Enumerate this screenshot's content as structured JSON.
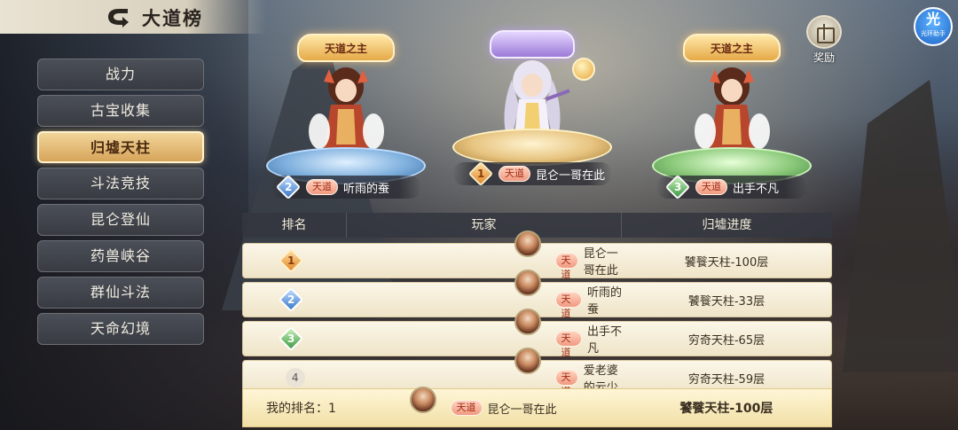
{
  "header": {
    "title": "大道榜"
  },
  "sidebar": {
    "items": [
      {
        "label": "战力",
        "active": false
      },
      {
        "label": "古宝收集",
        "active": false
      },
      {
        "label": "归墟天柱",
        "active": true
      },
      {
        "label": "斗法竞技",
        "active": false
      },
      {
        "label": "昆仑登仙",
        "active": false
      },
      {
        "label": "药兽峡谷",
        "active": false
      },
      {
        "label": "群仙斗法",
        "active": false
      },
      {
        "label": "天命幻境",
        "active": false
      }
    ]
  },
  "podiums": {
    "first": {
      "rank": "1",
      "crest": "",
      "tag": "天道",
      "name": "昆仑一哥在此"
    },
    "second": {
      "rank": "2",
      "crest": "天道之主",
      "tag": "天道",
      "name": "听雨的蚕"
    },
    "third": {
      "rank": "3",
      "crest": "天道之主",
      "tag": "天道",
      "name": "出手不凡"
    }
  },
  "reward": {
    "label": "奖励",
    "icon": "gift-icon"
  },
  "assist": {
    "big": "光",
    "small": "光环助手"
  },
  "table": {
    "headers": {
      "rank": "排名",
      "player": "玩家",
      "progress": "归墟进度"
    },
    "rows": [
      {
        "rank": "1",
        "tag": "天道",
        "name": "昆仑一哥在此",
        "progress": "饕餮天柱-100层"
      },
      {
        "rank": "2",
        "tag": "天道",
        "name": "听雨的蚕",
        "progress": "饕餮天柱-33层"
      },
      {
        "rank": "3",
        "tag": "天道",
        "name": "出手不凡",
        "progress": "穷奇天柱-65层"
      },
      {
        "rank": "4",
        "tag": "天道",
        "name": "爱老婆的云少",
        "progress": "穷奇天柱-59层"
      }
    ]
  },
  "my_rank": {
    "label": "我的排名：1",
    "tag": "天道",
    "name": "昆仑一哥在此",
    "progress": "饕餮天柱-100层"
  },
  "colors": {
    "active_tab": "#d6a45a",
    "tag": "#f09a80",
    "rank1": "#e08a2a",
    "rank2": "#3a78c8",
    "rank3": "#3e9a46"
  }
}
